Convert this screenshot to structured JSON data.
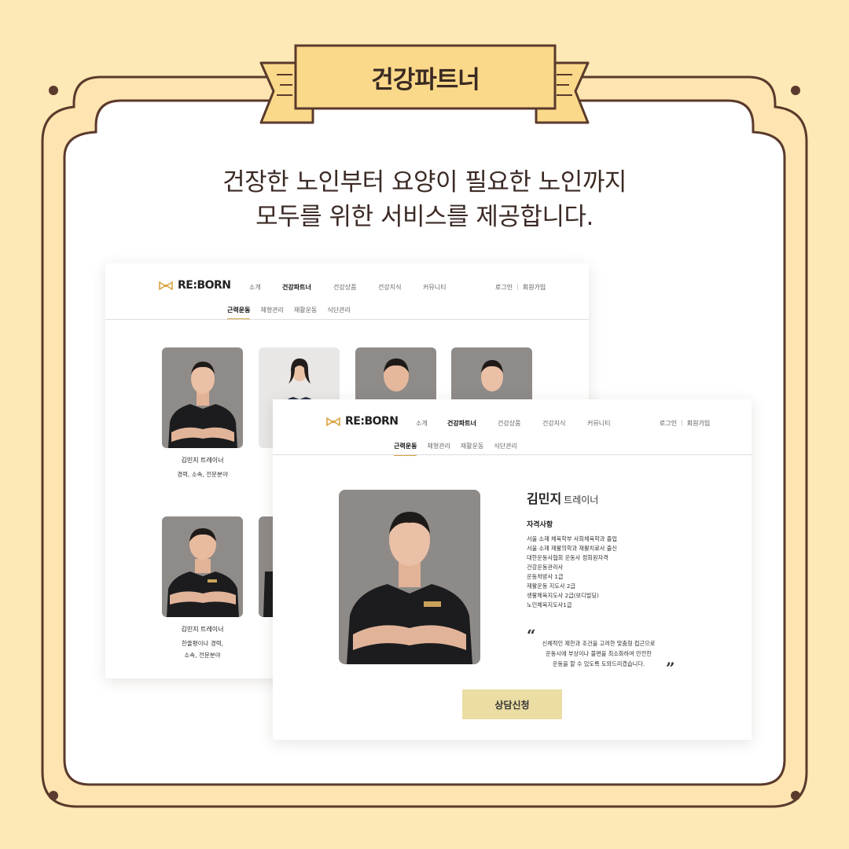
{
  "banner": {
    "title": "건강파트너"
  },
  "headline": {
    "line1": "건장한 노인부터 요양이 필요한 노인까지",
    "line2": "모두를 위한 서비스를 제공합니다."
  },
  "colors": {
    "background": "#FDE9B5",
    "frame_stroke": "#5A3A2C",
    "ribbon": "#FBD98A",
    "accent": "#D9A441",
    "cta": "#EBDDA3"
  },
  "site": {
    "logo": "RE:BORN",
    "menu": [
      "소개",
      "건강파트너",
      "건강상품",
      "건강지식",
      "커뮤니티"
    ],
    "active_menu": "건강파트너",
    "login": "로그인",
    "signup": "회원가입",
    "subnav": [
      "근력운동",
      "체형관리",
      "재활운동",
      "식단관리"
    ],
    "active_subnav": "근력운동"
  },
  "list_page": {
    "cards": [
      {
        "name": "김민지 트레이너",
        "desc_lines": [
          "경력, 소속, 전문분야"
        ]
      },
      {
        "name": "",
        "desc_lines": []
      },
      {
        "name": "",
        "desc_lines": []
      },
      {
        "name": "",
        "desc_lines": []
      },
      {
        "name": "김민지 트레이너",
        "desc_lines": [
          "한줄평이나 경력,",
          "소속, 전문분야"
        ]
      },
      {
        "name": "",
        "desc_lines": []
      }
    ]
  },
  "detail_page": {
    "name": "김민지",
    "role": "트레이너",
    "qualifications_title": "자격사항",
    "qualifications": [
      "서울 소재 체육학부 사회체육학과 졸업",
      "서울 소재 재활의학과 재활치료사 출신",
      "대한운동사협회 운동사 정회원자격",
      "건강운동관리사",
      "운동처방사 1급",
      "재활운동 지도사 2급",
      "생활체육지도사 2급(보디빌딩)",
      "노인체육지도사1급"
    ],
    "quote_open": "“",
    "quote_close": "”",
    "quote_lines": [
      "신체적인 제한과 조건을 고려한 맞춤형 접근으로",
      "운동시에 부상이나 불편을 최소화하여 안전한",
      "운동을 할 수 있도록 도와드리겠습니다."
    ],
    "cta_label": "상담신청"
  }
}
